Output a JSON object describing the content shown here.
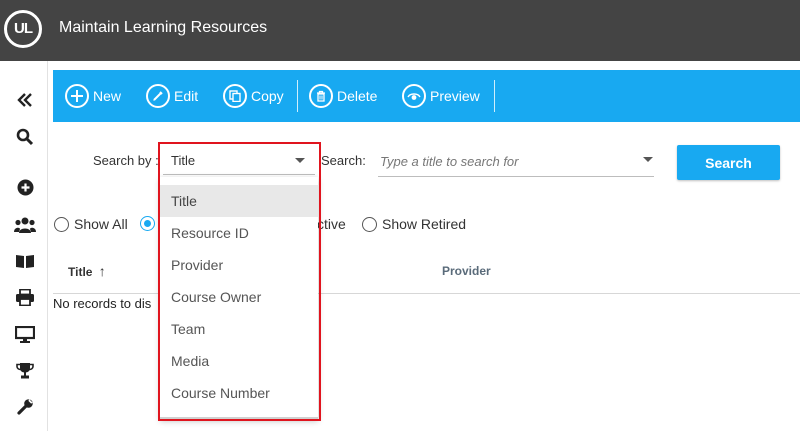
{
  "header": {
    "logo_text": "UL",
    "title": "Maintain Learning Resources"
  },
  "rail": {
    "icons": [
      "collapse-icon",
      "search-icon",
      "add-circle-icon",
      "users-icon",
      "book-icon",
      "printer-icon",
      "monitor-icon",
      "trophy-icon",
      "wrench-icon"
    ]
  },
  "toolbar": {
    "new_label": "New",
    "edit_label": "Edit",
    "copy_label": "Copy",
    "delete_label": "Delete",
    "preview_label": "Preview"
  },
  "search": {
    "search_by_label": "Search by :",
    "search_by_value": "Title",
    "search_label": "Search:",
    "placeholder": "Type a title to search for",
    "button_label": "Search"
  },
  "filters": {
    "show_all": "Show All",
    "show_active_partial": "ctive",
    "show_retired": "Show Retired",
    "selected": "show_active"
  },
  "table": {
    "col_title": "Title",
    "sort_indicator": "↑",
    "col_provider": "Provider",
    "empty_text": "No records to dis"
  },
  "dropdown": {
    "options": [
      "Title",
      "Resource ID",
      "Provider",
      "Course Owner",
      "Team",
      "Media",
      "Course Number"
    ],
    "selected_index": 0
  },
  "colors": {
    "accent": "#18a9f1",
    "header_bg": "#444444",
    "highlight": "#e0141e"
  }
}
